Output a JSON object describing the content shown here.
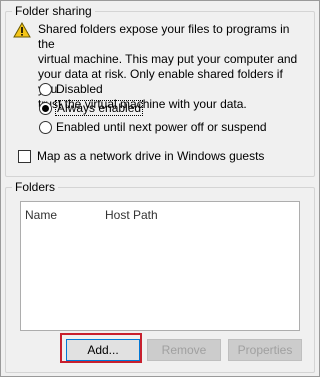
{
  "folder_sharing": {
    "title": "Folder sharing",
    "warning_lines": [
      "Shared folders expose your files to programs in the",
      "virtual machine. This may put your computer and",
      "your data at risk. Only enable shared folders if you",
      "trust the virtual machine with your data."
    ],
    "options": [
      {
        "label": "Disabled",
        "selected": false
      },
      {
        "label": "Always enabled",
        "selected": true
      },
      {
        "label": "Enabled until next power off or suspend",
        "selected": false
      }
    ],
    "map_network_drive_label": "Map as a network drive in Windows guests",
    "map_network_drive_checked": false
  },
  "folders": {
    "title": "Folders",
    "columns": [
      "Name",
      "Host Path"
    ],
    "rows": [],
    "buttons": {
      "add": "Add...",
      "remove": "Remove",
      "properties": "Properties"
    }
  },
  "colors": {
    "highlight": "#c8202e",
    "warning": "#f5c518"
  }
}
